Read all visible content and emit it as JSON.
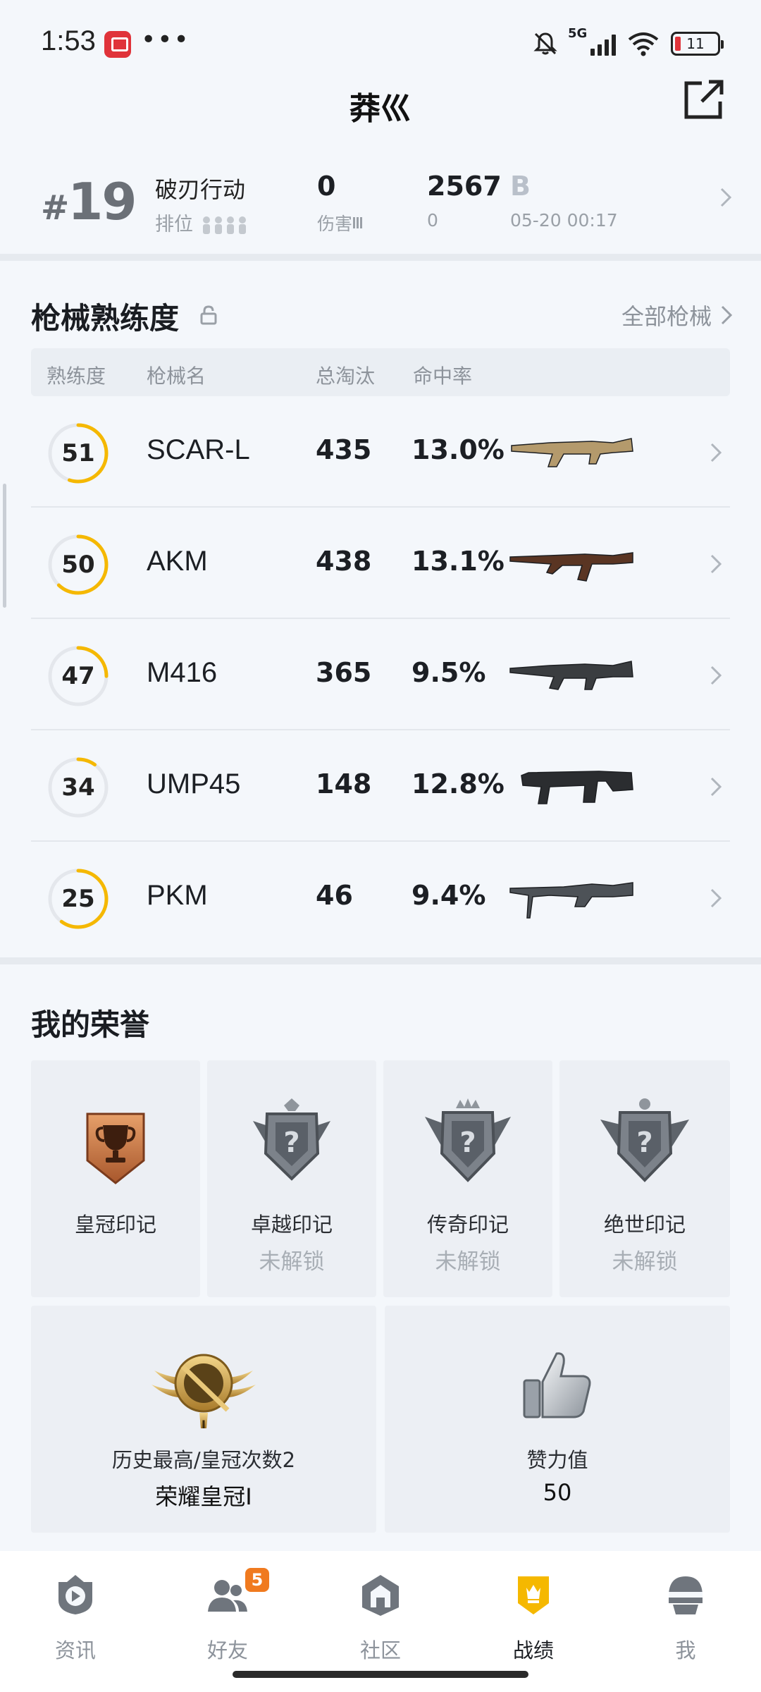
{
  "status_bar": {
    "time": "1:53",
    "dots": "•••",
    "network": "5G",
    "battery": "11"
  },
  "header": {
    "title": "莽巛"
  },
  "recent_match": {
    "rank": "19",
    "mode": "破刃行动",
    "rank_label": "排位",
    "kills": "0",
    "damage_label": "伤害",
    "score": "2567",
    "score_sub": "0",
    "grade": "B",
    "time": "05-20 00:17"
  },
  "weapons": {
    "title": "枪械熟练度",
    "all_label": "全部枪械",
    "columns": [
      "熟练度",
      "枪械名",
      "总淘汰",
      "命中率"
    ],
    "rows": [
      {
        "level": "51",
        "progress": 0.55,
        "name": "SCAR-L",
        "kills": "435",
        "accuracy": "13.0%",
        "icon": "scar-l-rifle-icon"
      },
      {
        "level": "50",
        "progress": 0.62,
        "name": "AKM",
        "kills": "438",
        "accuracy": "13.1%",
        "icon": "akm-rifle-icon"
      },
      {
        "level": "47",
        "progress": 0.25,
        "name": "M416",
        "kills": "365",
        "accuracy": "9.5%",
        "icon": "m416-rifle-icon"
      },
      {
        "level": "34",
        "progress": 0.1,
        "name": "UMP45",
        "kills": "148",
        "accuracy": "12.8%",
        "icon": "ump45-smg-icon"
      },
      {
        "level": "25",
        "progress": 0.6,
        "name": "PKM",
        "kills": "46",
        "accuracy": "9.4%",
        "icon": "pkm-mg-icon"
      }
    ]
  },
  "honors": {
    "title": "我的荣誉",
    "badges": [
      {
        "name": "皇冠印记",
        "status": ""
      },
      {
        "name": "卓越印记",
        "status": "未解锁"
      },
      {
        "name": "传奇印记",
        "status": "未解锁"
      },
      {
        "name": "绝世印记",
        "status": "未解锁"
      }
    ],
    "peak": {
      "label": "历史最高/皇冠次数2",
      "value": "荣耀皇冠I"
    },
    "likes": {
      "label": "赞力值",
      "value": "50"
    }
  },
  "colors": {
    "accent": "#f5b800",
    "text": "#1c1f24",
    "muted": "#8d939b",
    "ring_track": "#e4e7ec"
  },
  "bottom_nav": [
    {
      "label": "资讯",
      "icon": "news-icon",
      "badge": ""
    },
    {
      "label": "好友",
      "icon": "friends-icon",
      "badge": "5"
    },
    {
      "label": "社区",
      "icon": "community-icon",
      "badge": ""
    },
    {
      "label": "战绩",
      "icon": "record-icon",
      "badge": "",
      "active": true
    },
    {
      "label": "我",
      "icon": "profile-icon",
      "badge": ""
    }
  ]
}
